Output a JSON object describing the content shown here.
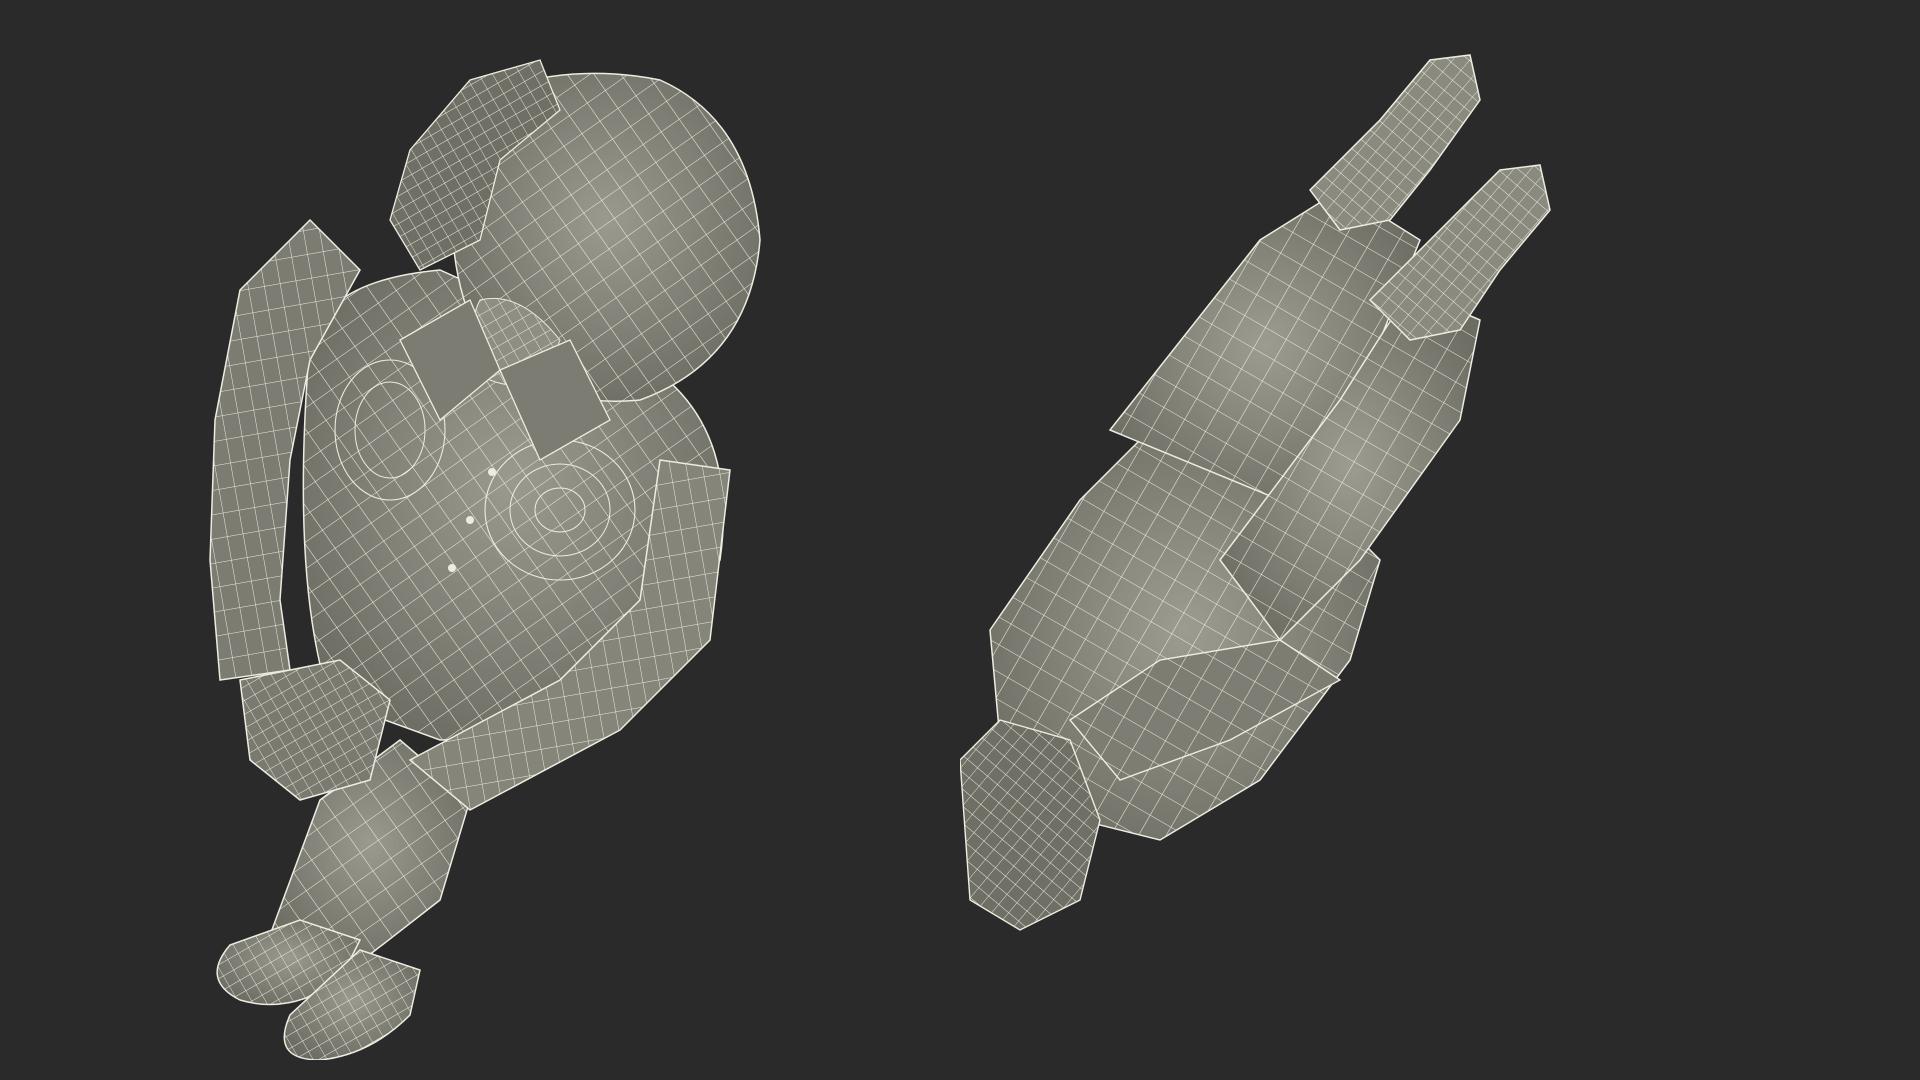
{
  "scene": {
    "background_color": "#2a2a2a",
    "mesh_fill_color": "#8b8b80",
    "mesh_shade_color": "#6f6f66",
    "mesh_highlight_color": "#a3a397",
    "wire_color": "#ecece0"
  },
  "views": [
    {
      "name": "top-view-seated-figure-left",
      "content": "wireframe-seated-woman-top-view"
    },
    {
      "name": "top-view-seated-figure-right",
      "content": "wireframe-seated-woman-top-view-rotated"
    }
  ]
}
